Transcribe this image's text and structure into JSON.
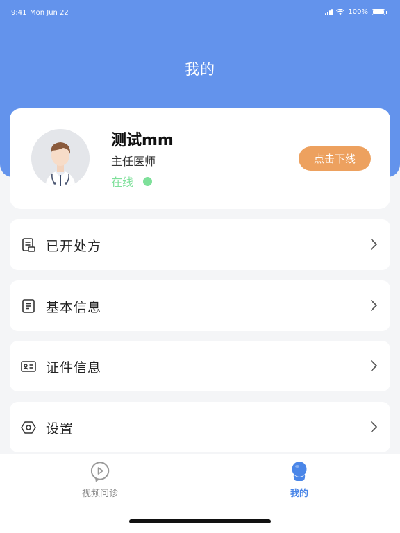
{
  "status_bar": {
    "time": "9:41",
    "date": "Mon Jun 22",
    "battery": "100%"
  },
  "header": {
    "title": "我的"
  },
  "profile": {
    "name": "测试mm",
    "title": "主任医师",
    "status": "在线",
    "offline_button": "点击下线"
  },
  "menu": {
    "items": [
      {
        "label": "已开处方",
        "icon": "prescription-icon"
      },
      {
        "label": "基本信息",
        "icon": "document-icon"
      },
      {
        "label": "证件信息",
        "icon": "id-card-icon"
      },
      {
        "label": "设置",
        "icon": "hexagon-settings-icon"
      }
    ]
  },
  "tabs": [
    {
      "label": "视频问诊",
      "icon": "video-play-icon",
      "active": false
    },
    {
      "label": "我的",
      "icon": "person-icon",
      "active": true
    }
  ],
  "colors": {
    "header": "#6393ec",
    "offline_button": "#eda15f",
    "online": "#7ee09a",
    "active_tab": "#4a86e8",
    "inactive_tab": "#888888"
  }
}
